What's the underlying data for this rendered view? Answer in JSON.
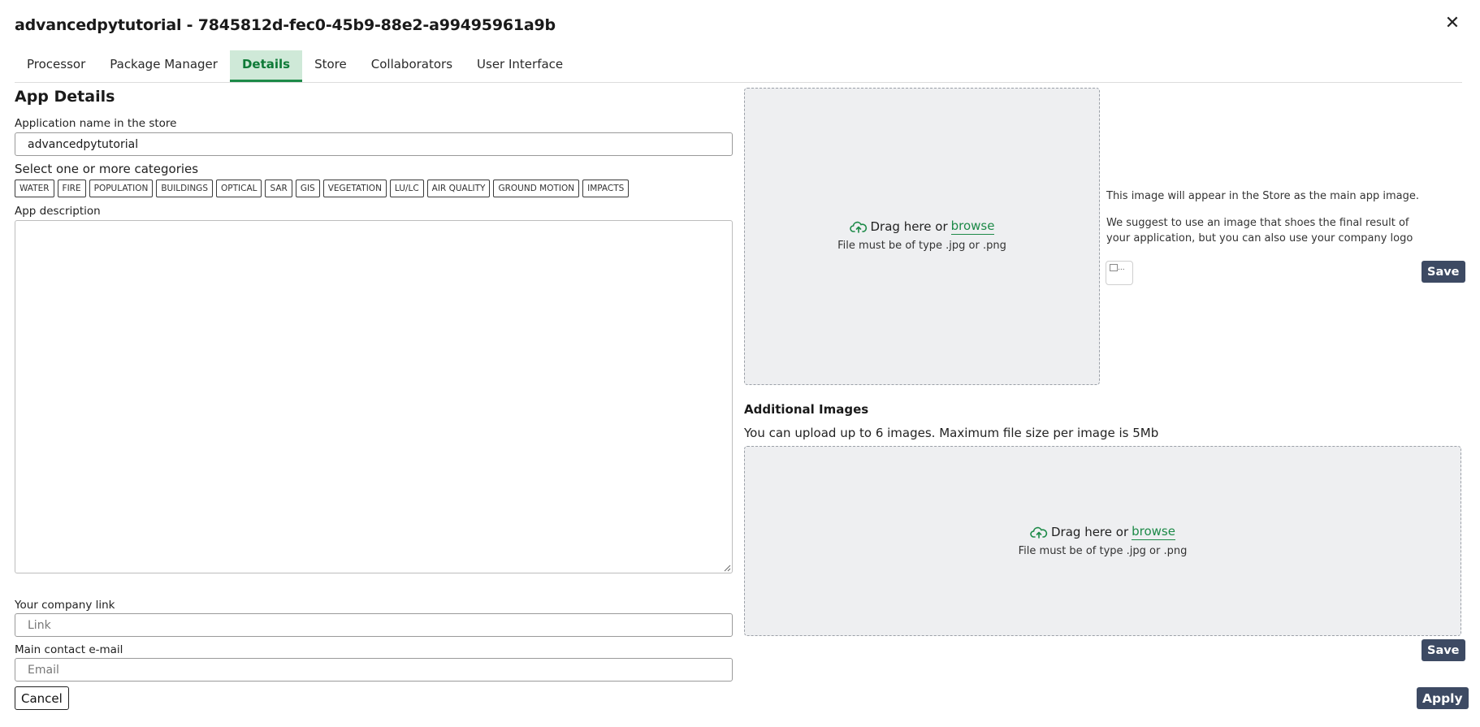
{
  "dialog": {
    "title": "advancedpytutorial - 7845812d-fec0-45b9-88e2-a99495961a9b",
    "close_symbol": "✕"
  },
  "tabs": [
    {
      "label": "Processor",
      "active": false
    },
    {
      "label": "Package Manager",
      "active": false
    },
    {
      "label": "Details",
      "active": true
    },
    {
      "label": "Store",
      "active": false
    },
    {
      "label": "Collaborators",
      "active": false
    },
    {
      "label": "User Interface",
      "active": false
    }
  ],
  "details": {
    "heading": "App Details",
    "app_name_label": "Application name in the store",
    "app_name_value": "advancedpytutorial",
    "categories_label": "Select one or more categories",
    "categories": [
      "WATER",
      "FIRE",
      "POPULATION",
      "BUILDINGS",
      "OPTICAL",
      "SAR",
      "GIS",
      "VEGETATION",
      "LU/LC",
      "AIR QUALITY",
      "GROUND MOTION",
      "IMPACTS"
    ],
    "description_label": "App description",
    "description_value": "",
    "company_link_label": "Your company link",
    "company_link_placeholder": "Link",
    "contact_email_label": "Main contact e-mail",
    "contact_email_placeholder": "Email"
  },
  "main_image": {
    "drop_text": "Drag here or",
    "browse_text": "browse",
    "file_hint": "File must be of type .jpg or .png",
    "info_1": "This image will appear in the Store as the main app image.",
    "info_2": "We suggest to use an image that shoes the final result of your application, but you can also use your company logo",
    "thumb_alt": "...",
    "save_label": "Save"
  },
  "additional_images": {
    "heading": "Additional Images",
    "note": "You can upload up to 6 images. Maximum file size per image is 5Mb",
    "drop_text": "Drag here or",
    "browse_text": "browse",
    "file_hint": "File must be of type .jpg or .png",
    "save_label": "Save"
  },
  "footer": {
    "cancel_label": "Cancel",
    "apply_label": "Apply"
  },
  "colors": {
    "accent_green": "#1d8a48",
    "tab_active_bg": "#cfe9d8",
    "button_dark": "#3d4a63",
    "dropzone_bg": "#eeeff1"
  }
}
